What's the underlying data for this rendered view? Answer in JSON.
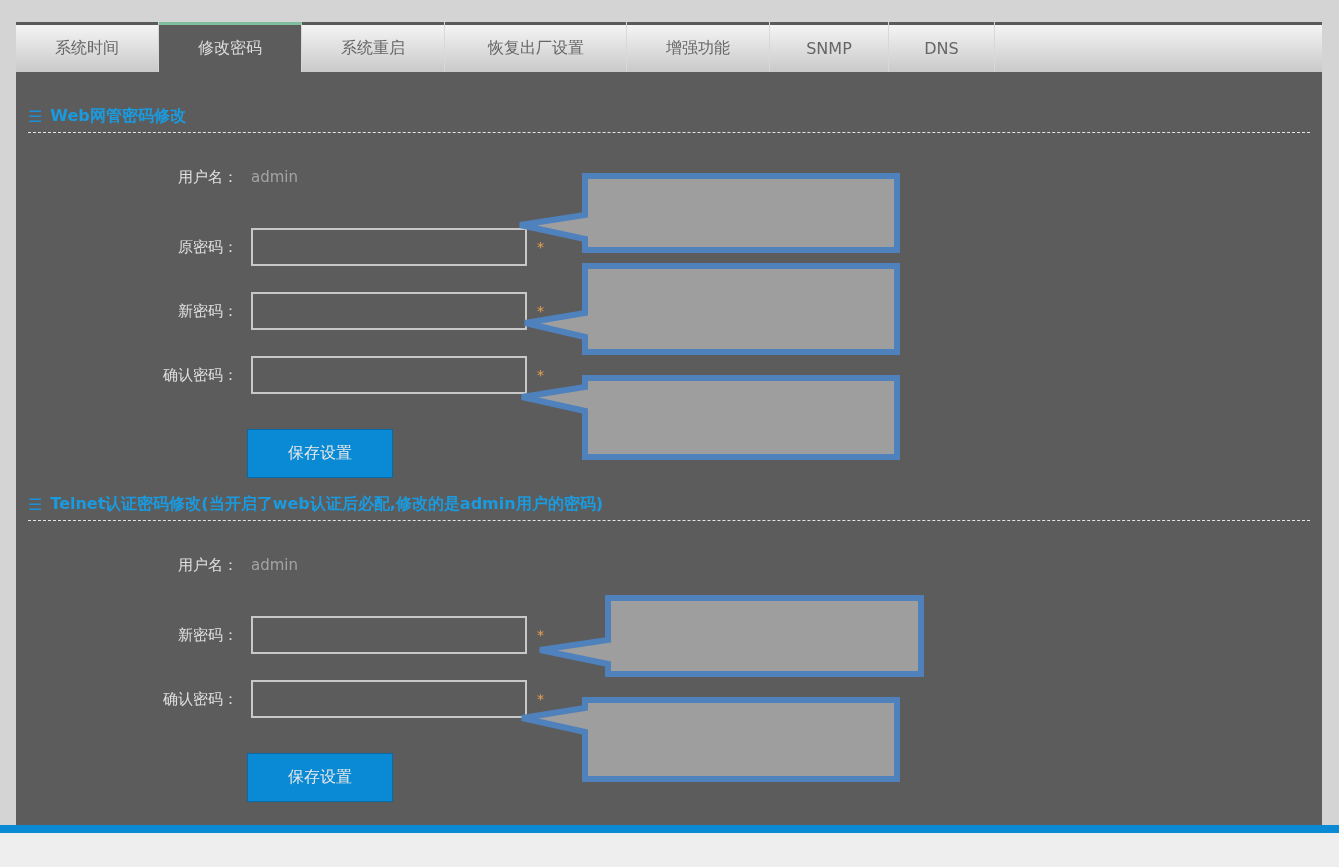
{
  "tabs": [
    {
      "label": "系统时间",
      "selected": false
    },
    {
      "label": "修改密码",
      "selected": true
    },
    {
      "label": "系统重启",
      "selected": false
    },
    {
      "label": "恢复出厂设置",
      "selected": false
    },
    {
      "label": "增强功能",
      "selected": false
    },
    {
      "label": "SNMP",
      "selected": false
    },
    {
      "label": "DNS",
      "selected": false
    }
  ],
  "sections": [
    {
      "icon": "☰",
      "title": "Web网管密码修改",
      "fields": [
        {
          "kind": "text",
          "label": "用户名：",
          "value": "admin"
        },
        {
          "kind": "input",
          "label": "原密码：",
          "required": "*"
        },
        {
          "kind": "input",
          "label": "新密码：",
          "required": "*"
        },
        {
          "kind": "input",
          "label": "确认密码：",
          "required": "*"
        }
      ],
      "button": "保存设置"
    },
    {
      "icon": "☰",
      "title": "Telnet认证密码修改(当开启了web认证后必配,修改的是admin用户的密码)",
      "fields": [
        {
          "kind": "text",
          "label": "用户名：",
          "value": "admin"
        },
        {
          "kind": "input",
          "label": "新密码：",
          "required": "*"
        },
        {
          "kind": "input",
          "label": "确认密码：",
          "required": "*"
        }
      ],
      "button": "保存设置"
    }
  ]
}
